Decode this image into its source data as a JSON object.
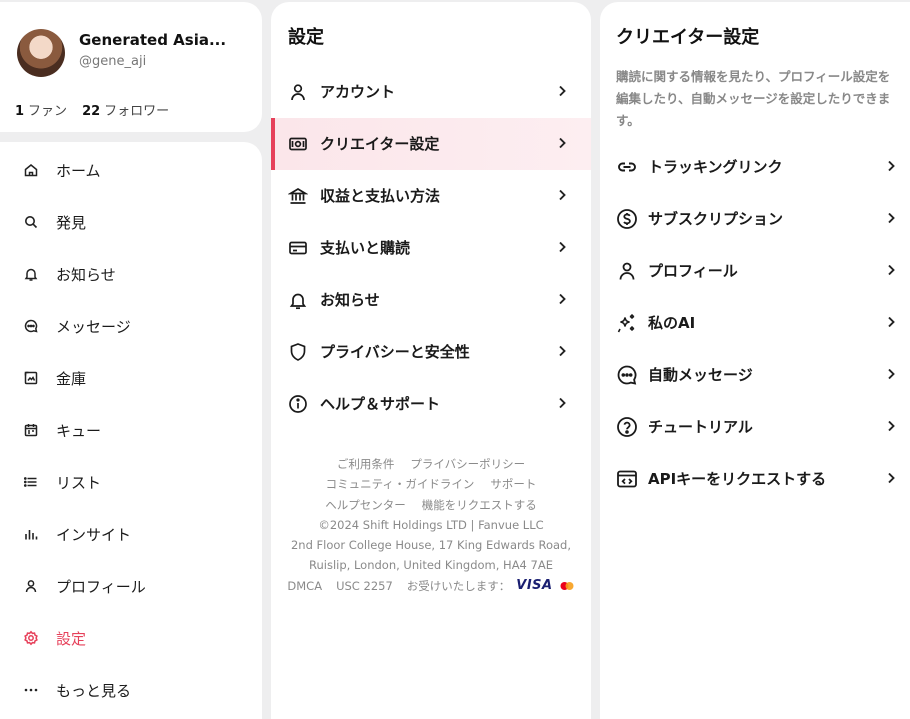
{
  "profile": {
    "display_name": "Generated Asia...",
    "handle": "@gene_aji",
    "fans_count": "1",
    "fans_label": "ファン",
    "followers_count": "22",
    "followers_label": "フォロワー"
  },
  "nav": {
    "items": [
      {
        "label": "ホーム",
        "icon": "home-icon"
      },
      {
        "label": "発見",
        "icon": "search-icon"
      },
      {
        "label": "お知らせ",
        "icon": "bell-icon"
      },
      {
        "label": "メッセージ",
        "icon": "message-icon"
      },
      {
        "label": "金庫",
        "icon": "vault-icon"
      },
      {
        "label": "キュー",
        "icon": "calendar-icon"
      },
      {
        "label": "リスト",
        "icon": "list-icon"
      },
      {
        "label": "インサイト",
        "icon": "insights-icon"
      },
      {
        "label": "プロフィール",
        "icon": "user-icon"
      },
      {
        "label": "設定",
        "icon": "settings-icon",
        "active": true
      },
      {
        "label": "もっと見る",
        "icon": "more-icon"
      }
    ],
    "active_color": "#e6405a"
  },
  "settings": {
    "title": "設定",
    "items": [
      {
        "label": "アカウント",
        "icon": "user-icon"
      },
      {
        "label": "クリエイター設定",
        "icon": "money-card-icon",
        "active": true
      },
      {
        "label": "収益と支払い方法",
        "icon": "bank-icon"
      },
      {
        "label": "支払いと購読",
        "icon": "credit-card-icon"
      },
      {
        "label": "お知らせ",
        "icon": "bell-icon"
      },
      {
        "label": "プライバシーと安全性",
        "icon": "shield-icon"
      },
      {
        "label": "ヘルプ＆サポート",
        "icon": "info-icon"
      }
    ]
  },
  "footer": {
    "terms": "ご利用条件",
    "privacy": "プライバシーポリシー",
    "guidelines": "コミュニティ・ガイドライン",
    "support": "サポート",
    "help_center": "ヘルプセンター",
    "feature_request": "機能をリクエストする",
    "copyright": "©2024 Shift Holdings LTD | Fanvue LLC",
    "address_line1": "2nd Floor College House, 17 King Edwards Road,",
    "address_line2": "Ruislip, London, United Kingdom, HA4 7AE",
    "dmca": "DMCA",
    "usc": "USC 2257",
    "we_accept": "お受けいたします：",
    "visa": "VISA"
  },
  "creator_settings": {
    "title": "クリエイター設定",
    "description": "購読に関する情報を見たり、プロフィール設定を編集したり、自動メッセージを設定したりできます。",
    "items": [
      {
        "label": "トラッキングリンク",
        "icon": "link-icon"
      },
      {
        "label": "サブスクリプション",
        "icon": "dollar-icon"
      },
      {
        "label": "プロフィール",
        "icon": "user-icon"
      },
      {
        "label": "私のAI",
        "icon": "sparkles-icon"
      },
      {
        "label": "自動メッセージ",
        "icon": "chat-icon"
      },
      {
        "label": "チュートリアル",
        "icon": "question-icon"
      },
      {
        "label": "APIキーをリクエストする",
        "icon": "code-window-icon"
      }
    ]
  }
}
